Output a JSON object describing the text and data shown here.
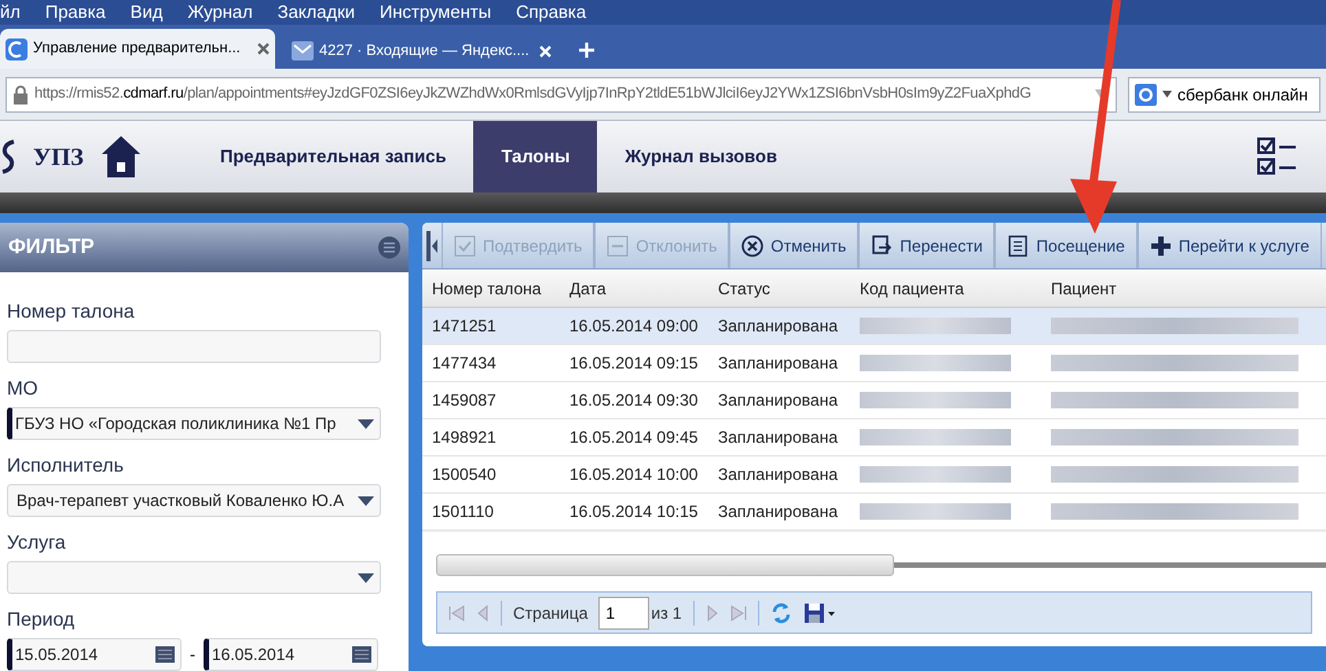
{
  "browser": {
    "menu": [
      "йл",
      "Правка",
      "Вид",
      "Журнал",
      "Закладки",
      "Инструменты",
      "Справка"
    ],
    "tabs": [
      {
        "title": "Управление предварительн...",
        "selected": true
      },
      {
        "title": "4227 · Входящие — Яндекс....",
        "selected": false
      }
    ],
    "url": {
      "host_before": "https://rmis52.",
      "host": "cdmarf.ru",
      "path": "/plan/appointments#eyJzdGF0ZSI6eyJkZWZhdWx0RmlsdGVyIjp7InRpY2tldE51bWJlciI6eyJ2YWx1ZSI6bnVsbH0sIm9yZ2FuaXphdG"
    },
    "search": "сбербанк онлайн"
  },
  "app": {
    "logo": "УПЗ",
    "nav": [
      {
        "label": "Предварительная запись",
        "selected": false
      },
      {
        "label": "Талоны",
        "selected": true
      },
      {
        "label": "Журнал вызовов",
        "selected": false
      }
    ]
  },
  "filter": {
    "title": "ФИЛЬТР",
    "fields": [
      {
        "kind": "text",
        "label": "Номер талона"
      },
      {
        "kind": "select",
        "label": "МО",
        "value": "ГБУЗ НО «Городская поликлиника №1 Пр",
        "required": true
      },
      {
        "kind": "select",
        "label": "Исполнитель",
        "value": "Врач-терапевт участковый Коваленко Ю.А",
        "required": false
      },
      {
        "kind": "select",
        "label": "Услуга",
        "required": false
      },
      {
        "kind": "period",
        "label": "Период",
        "from": "15.05.2014",
        "to": "16.05.2014",
        "separator": "-"
      }
    ]
  },
  "toolbar": [
    {
      "label": "Подтвердить",
      "disabled": true,
      "kind": "check"
    },
    {
      "label": "Отклонить",
      "disabled": true,
      "kind": "minus"
    },
    {
      "label": "Отменить",
      "disabled": false,
      "kind": "cancel"
    },
    {
      "label": "Перенести",
      "disabled": false,
      "kind": "move"
    },
    {
      "label": "Посещение",
      "disabled": false,
      "kind": "doc"
    },
    {
      "label": "Перейти к услуге",
      "disabled": false,
      "kind": "plus"
    }
  ],
  "table": {
    "columns": [
      "Номер талона",
      "Дата",
      "Статус",
      "Код пациента",
      "Пациент"
    ],
    "rows": [
      {
        "number": "1471251",
        "date": "16.05.2014 09:00",
        "status": "Запланирована",
        "redacted": true,
        "selected": true
      },
      {
        "number": "1477434",
        "date": "16.05.2014 09:15",
        "status": "Запланирована",
        "redacted": true,
        "selected": false
      },
      {
        "number": "1459087",
        "date": "16.05.2014 09:30",
        "status": "Запланирована",
        "redacted": true,
        "selected": false
      },
      {
        "number": "1498921",
        "date": "16.05.2014 09:45",
        "status": "Запланирована",
        "redacted": true,
        "selected": false
      },
      {
        "number": "1500540",
        "date": "16.05.2014 10:00",
        "status": "Запланирована",
        "redacted": true,
        "selected": false
      },
      {
        "number": "1501110",
        "date": "16.05.2014 10:15",
        "status": "Запланирована",
        "redacted": true,
        "selected": false
      }
    ]
  },
  "pager": {
    "page_label": "Страница",
    "page": "1",
    "of": "из 1"
  }
}
